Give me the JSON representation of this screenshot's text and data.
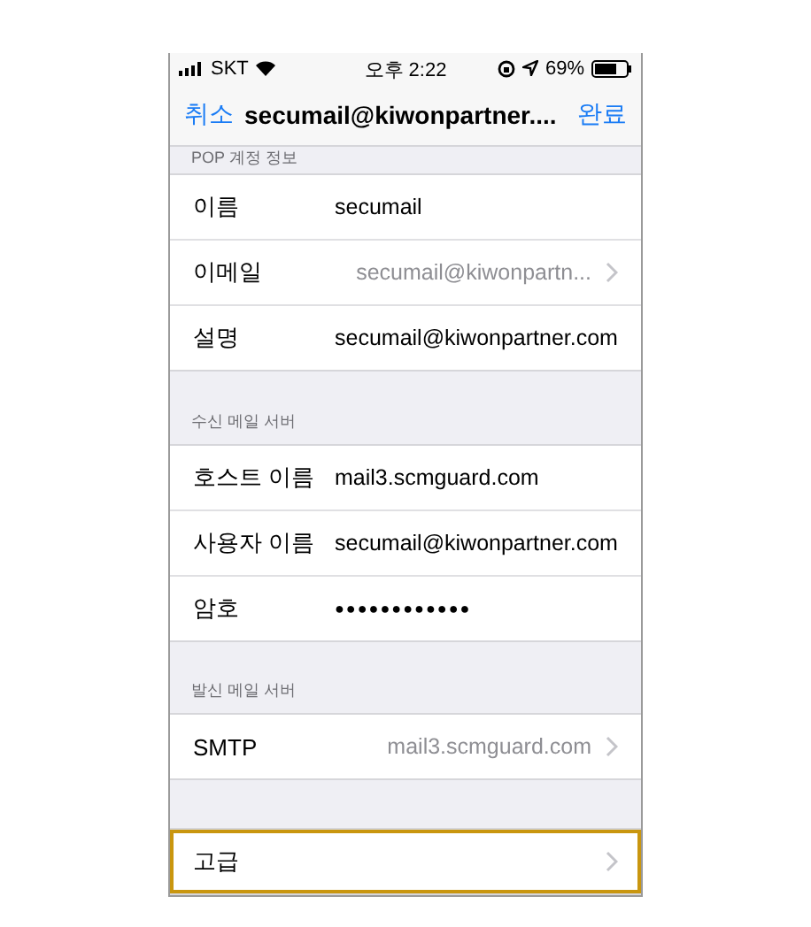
{
  "status_bar": {
    "carrier": "SKT",
    "time": "오후 2:22",
    "battery": "69%"
  },
  "nav_bar": {
    "cancel": "취소",
    "title": "secumail@kiwonpartner....",
    "done": "완료"
  },
  "sections": [
    {
      "header": "POP 계정 정보",
      "rows": [
        {
          "kind": "text",
          "label": "이름",
          "value": "secumail",
          "highlighted": false
        },
        {
          "kind": "link",
          "label": "이메일",
          "value": "secumail@kiwonpartn...",
          "highlighted": false
        },
        {
          "kind": "text",
          "label": "설명",
          "value": "secumail@kiwonpartner.com",
          "highlighted": false
        }
      ]
    },
    {
      "header": "수신 메일 서버",
      "rows": [
        {
          "kind": "text",
          "label": "호스트 이름",
          "value": "mail3.scmguard.com",
          "highlighted": false
        },
        {
          "kind": "text",
          "label": "사용자 이름",
          "value": "secumail@kiwonpartner.com",
          "highlighted": false
        },
        {
          "kind": "password",
          "label": "암호",
          "value": "●●●●●●●●●●●●",
          "highlighted": false
        }
      ]
    },
    {
      "header": "발신 메일 서버",
      "rows": [
        {
          "kind": "link",
          "label": "SMTP",
          "value": "mail3.scmguard.com",
          "highlighted": false
        }
      ]
    },
    {
      "rows": [
        {
          "kind": "link",
          "label": "고급",
          "highlighted": true
        }
      ]
    }
  ]
}
